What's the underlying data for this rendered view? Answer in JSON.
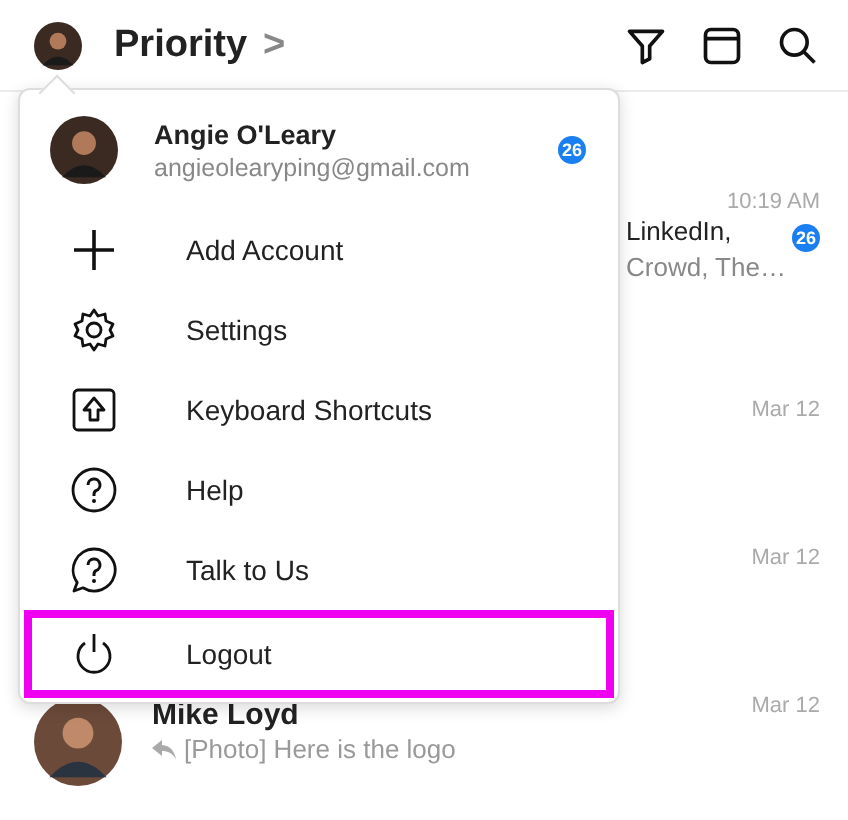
{
  "header": {
    "title": "Priority",
    "chevron": ">"
  },
  "threads": [
    {
      "time": "10:19 AM",
      "lines": [
        "LinkedIn,",
        "Crowd, The…"
      ],
      "badge": "26"
    },
    {
      "time": "Mar 12"
    },
    {
      "time": "Mar 12"
    },
    {
      "time": "Mar 12",
      "name": "Mike Loyd",
      "preview": "[Photo] Here is the logo",
      "replied": true
    }
  ],
  "menu": {
    "account": {
      "name": "Angie O'Leary",
      "email": "angieolearyping@gmail.com",
      "badge": "26"
    },
    "items": [
      {
        "kind": "add",
        "label": "Add Account",
        "selected": false
      },
      {
        "kind": "settings",
        "label": "Settings",
        "selected": false
      },
      {
        "kind": "keyboard",
        "label": "Keyboard Shortcuts",
        "selected": false
      },
      {
        "kind": "help",
        "label": "Help",
        "selected": false
      },
      {
        "kind": "talk",
        "label": "Talk to Us",
        "selected": false
      },
      {
        "kind": "logout",
        "label": "Logout",
        "selected": true
      }
    ]
  }
}
